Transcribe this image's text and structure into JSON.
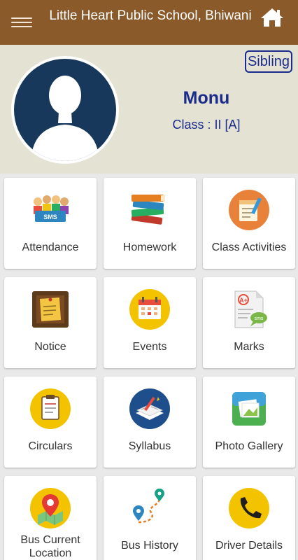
{
  "header": {
    "title": "Little Heart Public School, Bhiwani"
  },
  "profile": {
    "sibling_label": "Sibling",
    "name": "Monu",
    "class_label": "Class : II [A]"
  },
  "menu": [
    {
      "label": "Attendance",
      "icon": "attendance-icon"
    },
    {
      "label": "Homework",
      "icon": "books-icon"
    },
    {
      "label": "Class Activities",
      "icon": "notebook-icon"
    },
    {
      "label": "Notice",
      "icon": "notice-board-icon"
    },
    {
      "label": "Events",
      "icon": "calendar-icon"
    },
    {
      "label": "Marks",
      "icon": "marksheet-icon"
    },
    {
      "label": "Circulars",
      "icon": "document-icon"
    },
    {
      "label": "Syllabus",
      "icon": "open-book-icon"
    },
    {
      "label": "Photo Gallery",
      "icon": "photo-icon"
    },
    {
      "label": "Bus Current Location",
      "icon": "map-pin-icon"
    },
    {
      "label": "Bus History",
      "icon": "route-icon"
    },
    {
      "label": "Driver Details",
      "icon": "phone-icon"
    }
  ],
  "colors": {
    "header": "#8b5a2b",
    "profile_bg": "#e4e2d3",
    "accent": "#1a2b8c"
  }
}
